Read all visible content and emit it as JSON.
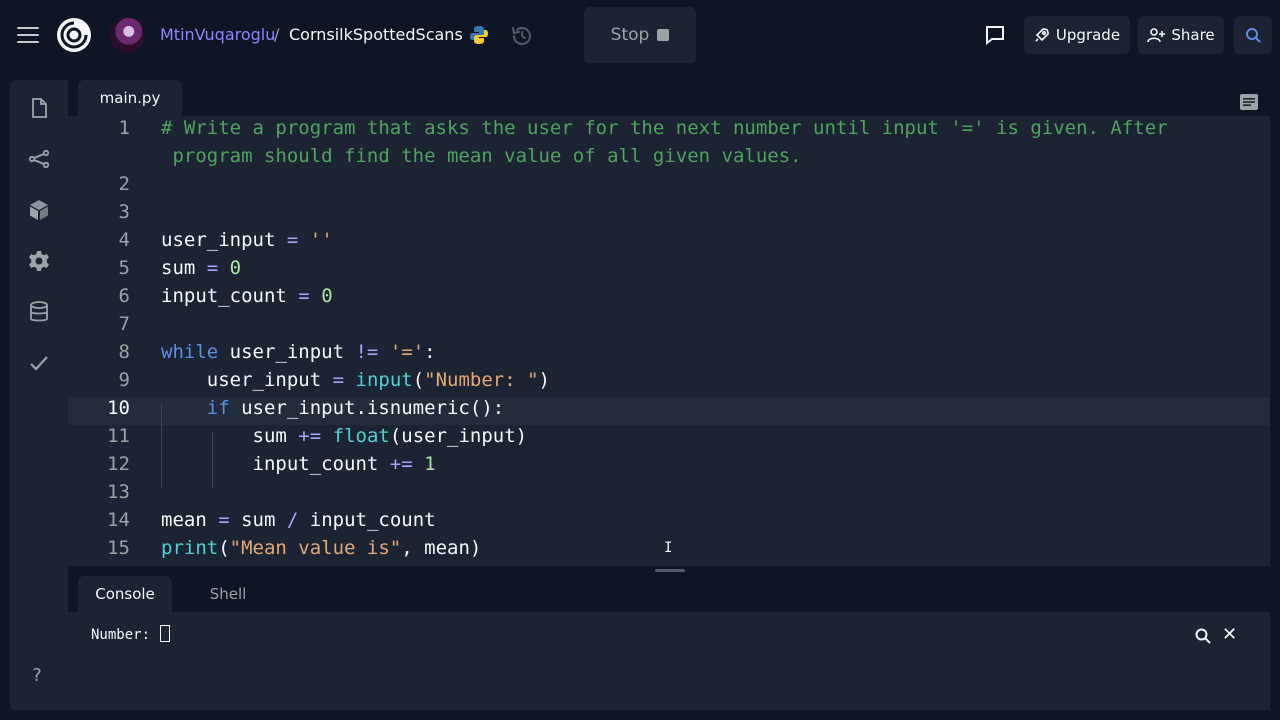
{
  "header": {
    "username": "MtinVuqaroglu",
    "separator": "/",
    "repl_name": "CornsilkSpottedScans",
    "stop_label": "Stop",
    "upgrade_label": "Upgrade",
    "share_label": "Share"
  },
  "sidebar": {
    "items": [
      "files-icon",
      "git-icon",
      "packages-icon",
      "settings-icon",
      "database-icon",
      "check-icon"
    ],
    "help_label": "?"
  },
  "editor": {
    "tab": "main.py",
    "active_line": 10,
    "lines": [
      {
        "n": "1",
        "text": "# Write a program that asks the user for the next number until input '=' is given. After"
      },
      {
        "n": "",
        "text": " program should find the mean value of all given values."
      },
      {
        "n": "2",
        "text": ""
      },
      {
        "n": "3",
        "text": ""
      },
      {
        "n": "4",
        "text": "user_input = ''"
      },
      {
        "n": "5",
        "text": "sum = 0"
      },
      {
        "n": "6",
        "text": "input_count = 0"
      },
      {
        "n": "7",
        "text": ""
      },
      {
        "n": "8",
        "text": "while user_input != '=':"
      },
      {
        "n": "9",
        "text": "    user_input = input(\"Number: \")"
      },
      {
        "n": "10",
        "text": "    if user_input.isnumeric():"
      },
      {
        "n": "11",
        "text": "        sum += float(user_input)"
      },
      {
        "n": "12",
        "text": "        input_count += 1"
      },
      {
        "n": "13",
        "text": ""
      },
      {
        "n": "14",
        "text": "mean = sum / input_count"
      },
      {
        "n": "15",
        "text": "print(\"Mean value is\", mean)"
      }
    ]
  },
  "console": {
    "tabs": [
      "Console",
      "Shell"
    ],
    "output": "Number: "
  },
  "colors": {
    "background": "#0e1525",
    "surface": "#1c2333",
    "accent": "#8f86ff",
    "comment": "#4fa35e",
    "keyword": "#5c8ee6",
    "string": "#e5a874",
    "function": "#4ed2d0",
    "number": "#a8e6a3"
  }
}
